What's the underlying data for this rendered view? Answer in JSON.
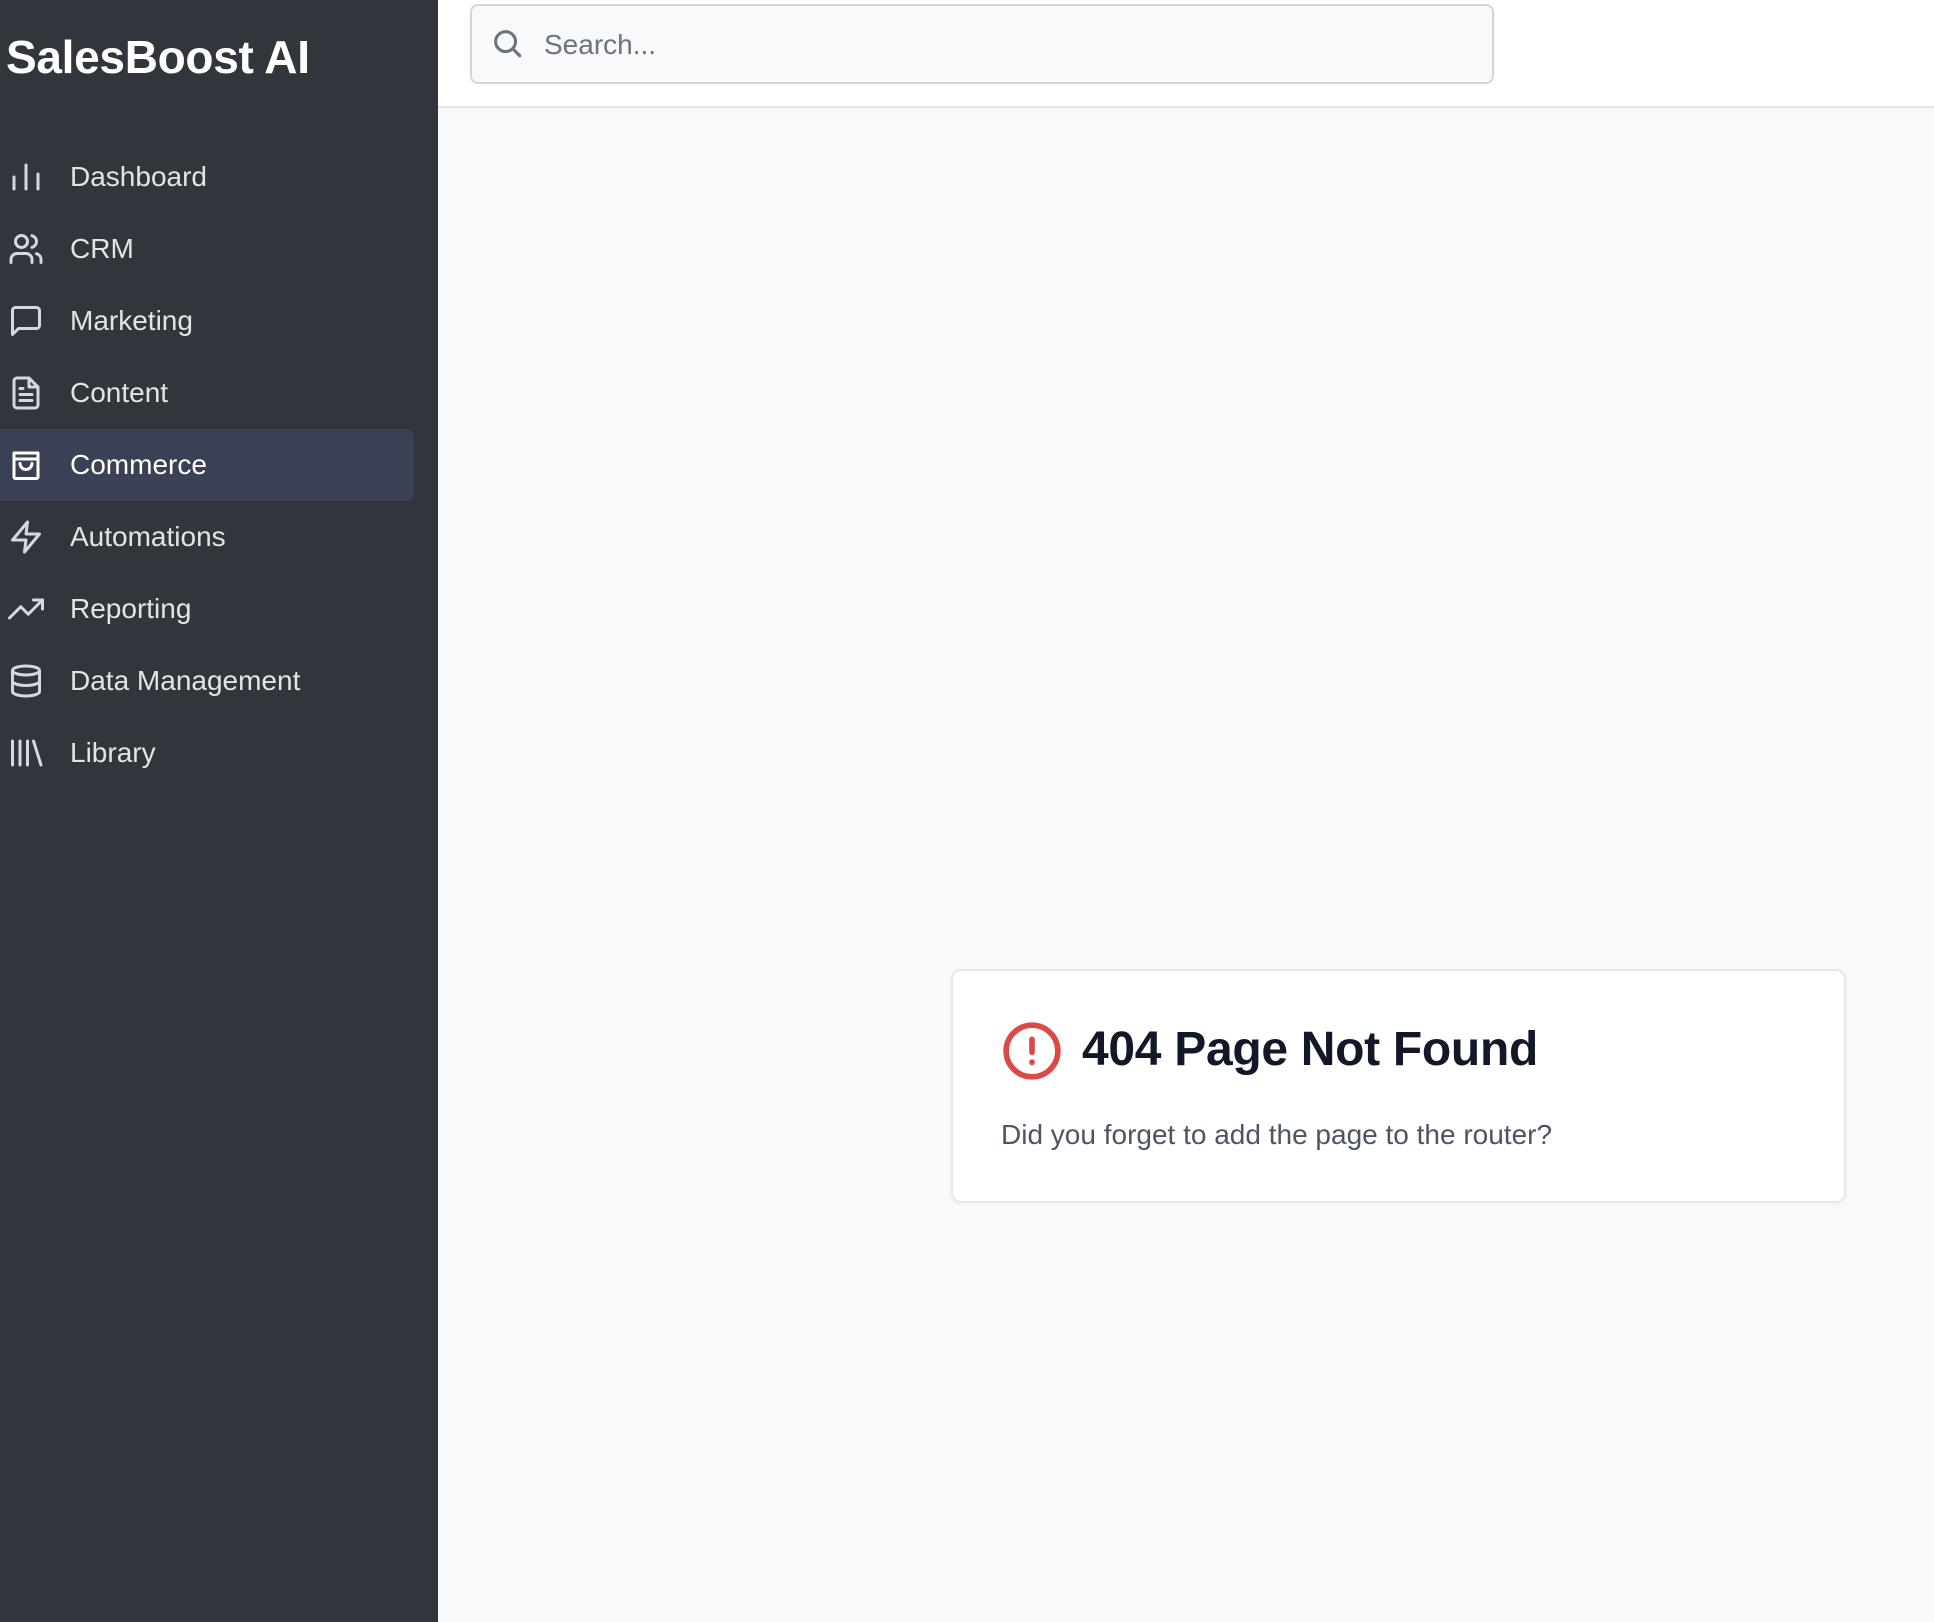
{
  "app": {
    "brand": "SalesBoost AI"
  },
  "sidebar": {
    "items": [
      {
        "label": "Dashboard",
        "icon": "bar-chart-icon",
        "active": false
      },
      {
        "label": "CRM",
        "icon": "users-icon",
        "active": false
      },
      {
        "label": "Marketing",
        "icon": "message-square-icon",
        "active": false
      },
      {
        "label": "Content",
        "icon": "file-text-icon",
        "active": false
      },
      {
        "label": "Commerce",
        "icon": "shopping-bag-icon",
        "active": true
      },
      {
        "label": "Automations",
        "icon": "zap-icon",
        "active": false
      },
      {
        "label": "Reporting",
        "icon": "trending-up-icon",
        "active": false
      },
      {
        "label": "Data Management",
        "icon": "database-icon",
        "active": false
      },
      {
        "label": "Library",
        "icon": "library-icon",
        "active": false
      }
    ]
  },
  "header": {
    "search": {
      "placeholder": "Search...",
      "value": ""
    }
  },
  "error_card": {
    "icon": "alert-circle-icon",
    "title": "404 Page Not Found",
    "message": "Did you forget to add the page to the router?"
  },
  "colors": {
    "sidebar_bg": "#31363c",
    "sidebar_active_bg": "#3a4155",
    "main_bg": "#f8f9fb",
    "alert": "#dc4a48"
  }
}
